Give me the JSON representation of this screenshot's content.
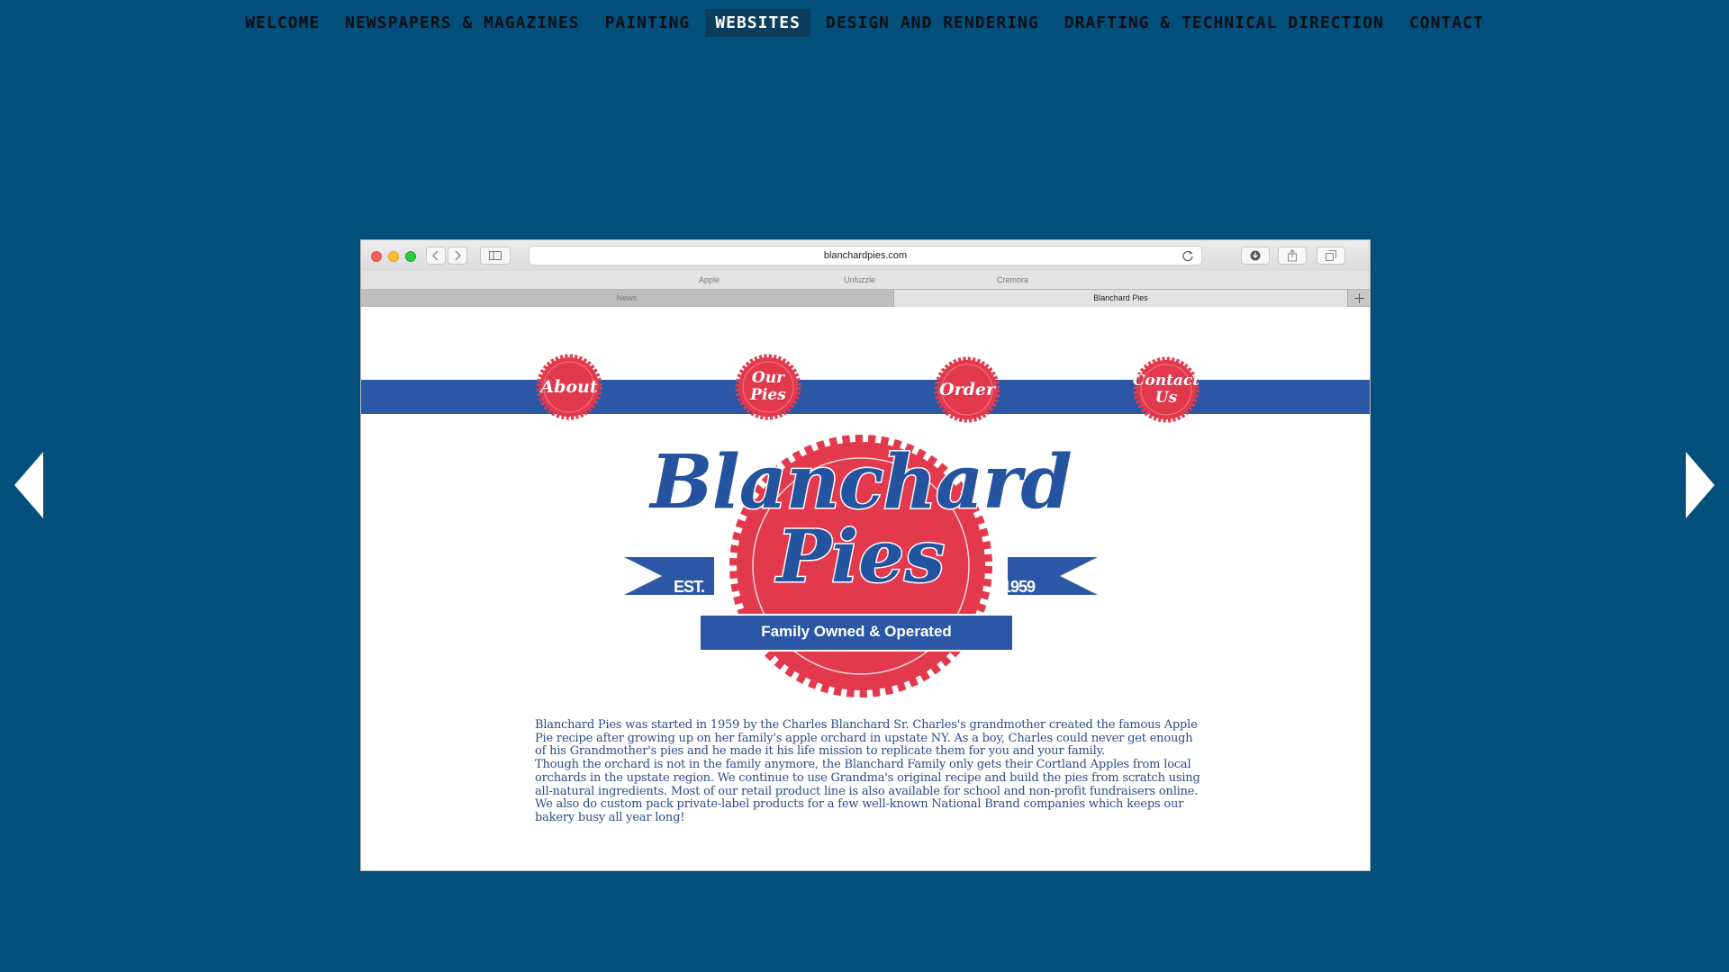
{
  "nav": {
    "items": [
      "Welcome",
      "Newspapers & Magazines",
      "Painting",
      "Websites",
      "Design and Rendering",
      "Drafting & Technical Direction",
      "Contact"
    ],
    "active": "Websites"
  },
  "browser": {
    "url": "blanchardpies.com",
    "favorites": [
      "Apple",
      "Unfuzzle",
      "Cremora"
    ],
    "tabs": {
      "inactive": "News",
      "current": "Blanchard Pies"
    }
  },
  "site": {
    "menu": {
      "about": "About",
      "our_pies": "Our\nPies",
      "order": "Order",
      "contact": "Contact\nUs"
    },
    "logo": {
      "title": "Blanchard",
      "subtitle": "Pies",
      "est": "EST.",
      "year": "1959",
      "tagline": "Family Owned & Operated"
    },
    "about_paragraph_1": "Blanchard Pies  was started in 1959 by the Charles Blanchard Sr.  Charles's grandmother created the famous Apple Pie recipe after growing up on her family's apple orchard in upstate NY.   As a boy, Charles could never get enough of his Grandmother's pies and he made it his life mission to replicate them for you and your family.",
    "about_paragraph_2": "Though the orchard is not in the family anymore, the Blanchard Family only gets their Cortland Apples from local orchards in the upstate region.  We continue to use Grandma's original recipe and build the pies from scratch using all-natural ingredients.  Most of our retail product line is also available for school and non-profit fundraisers online.  We also do custom pack private-label products for a few well-known National Brand companies which keeps our bakery busy all year long!"
  },
  "colors": {
    "page_background": "#02507b",
    "brand_red": "#e2394d",
    "brand_blue": "#2b57a6"
  },
  "icons": [
    "previous-arrow-icon",
    "next-arrow-icon",
    "back-chevron-icon",
    "forward-chevron-icon",
    "sidebar-icon",
    "reload-icon",
    "download-icon",
    "share-icon",
    "tabs-overview-icon",
    "plus-icon"
  ]
}
